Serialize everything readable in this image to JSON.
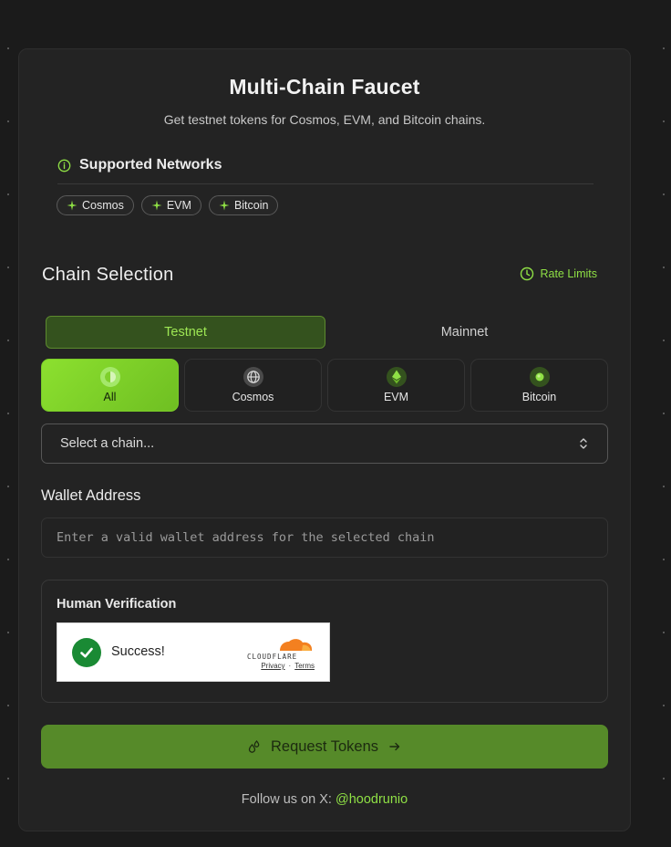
{
  "header": {
    "title": "Multi-Chain Faucet",
    "subtitle": "Get testnet tokens for Cosmos, EVM, and Bitcoin chains."
  },
  "networks": {
    "heading": "Supported Networks",
    "chips": [
      "Cosmos",
      "EVM",
      "Bitcoin"
    ]
  },
  "chain_selection": {
    "title": "Chain Selection",
    "rate_limits_label": "Rate Limits",
    "tabs": [
      {
        "label": "Testnet",
        "active": true
      },
      {
        "label": "Mainnet",
        "active": false
      }
    ],
    "filters": [
      {
        "label": "All",
        "icon": "all-chains-icon",
        "active": true
      },
      {
        "label": "Cosmos",
        "icon": "globe-icon",
        "active": false
      },
      {
        "label": "EVM",
        "icon": "ethereum-icon",
        "active": false
      },
      {
        "label": "Bitcoin",
        "icon": "bitcoin-icon",
        "active": false
      }
    ],
    "select_value": "Select a chain..."
  },
  "wallet": {
    "label": "Wallet Address",
    "placeholder": "Enter a valid wallet address for the selected chain",
    "value": ""
  },
  "verification": {
    "title": "Human Verification",
    "status": "Success!",
    "privacy_label": "Privacy",
    "separator": "·",
    "terms_label": "Terms",
    "brand": "CLOUDFLARE"
  },
  "request": {
    "label": "Request Tokens"
  },
  "footer": {
    "follow_text": "Follow us on X:",
    "handle": "@hoodrunio"
  },
  "colors": {
    "accent": "#8fe045",
    "button": "#568a29",
    "background": "#1b1b1b",
    "card": "#232323"
  }
}
